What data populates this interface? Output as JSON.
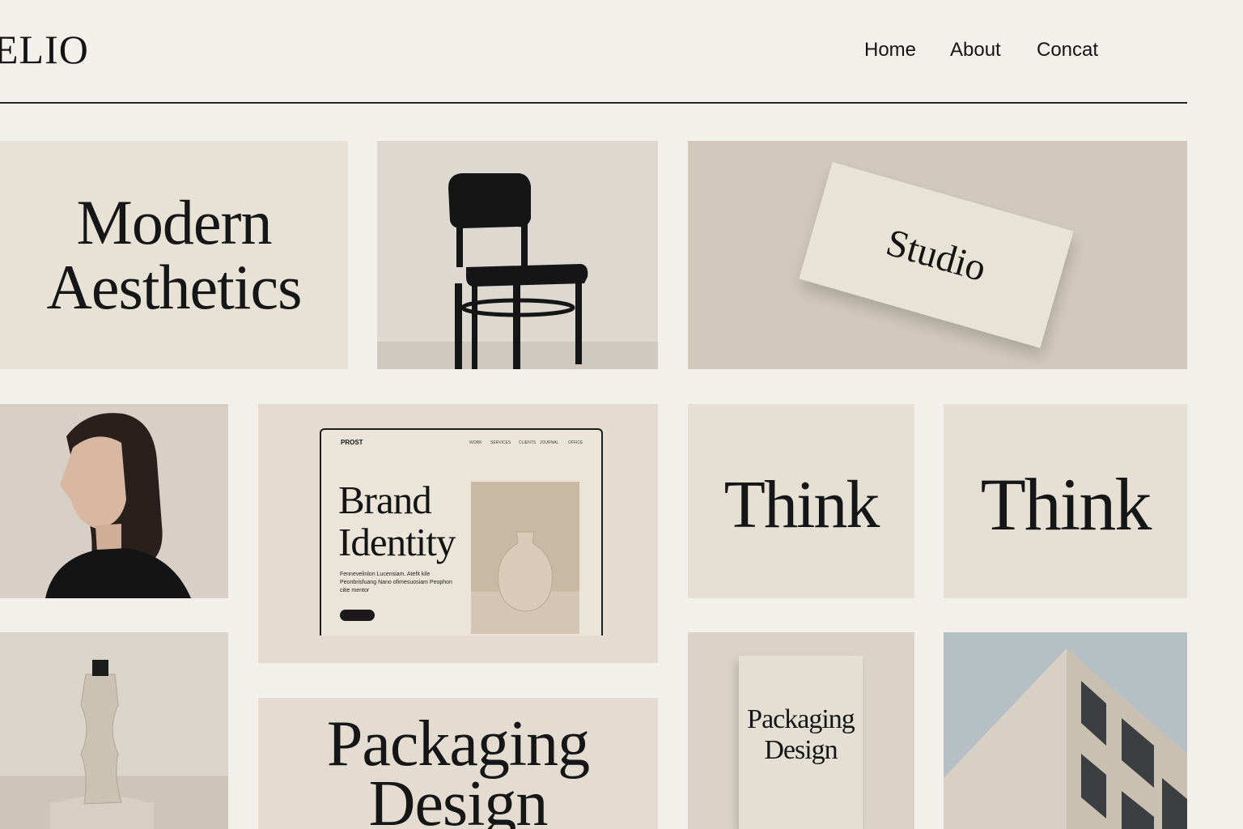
{
  "header": {
    "logo": "ELIO",
    "nav": [
      "Home",
      "About",
      "Concat"
    ]
  },
  "tiles": {
    "modern": "Modern\nAesthetics",
    "studio_card": "Studio",
    "brand": {
      "logo": "PROST",
      "nav": [
        "WORK",
        "SERVICES",
        "CLIENTS",
        "JOURNAL",
        "OFFICE"
      ],
      "title_line1": "Brand",
      "title_line2": "Identity",
      "body": "Fennevelinlon Lucensiam. Atefit kile Peonbrisfuang Nano ofimesuosiam Peophon citie mentor"
    },
    "think_1": "Think",
    "think_2": "Think",
    "packaging_line1": "Packaging",
    "packaging_line2": "Design",
    "packaging_box_line1": "Packaging",
    "packaging_box_line2": "Design"
  },
  "colors": {
    "background": "#f3f0ea",
    "tile": "#e6dfd3",
    "ink": "#141414"
  }
}
